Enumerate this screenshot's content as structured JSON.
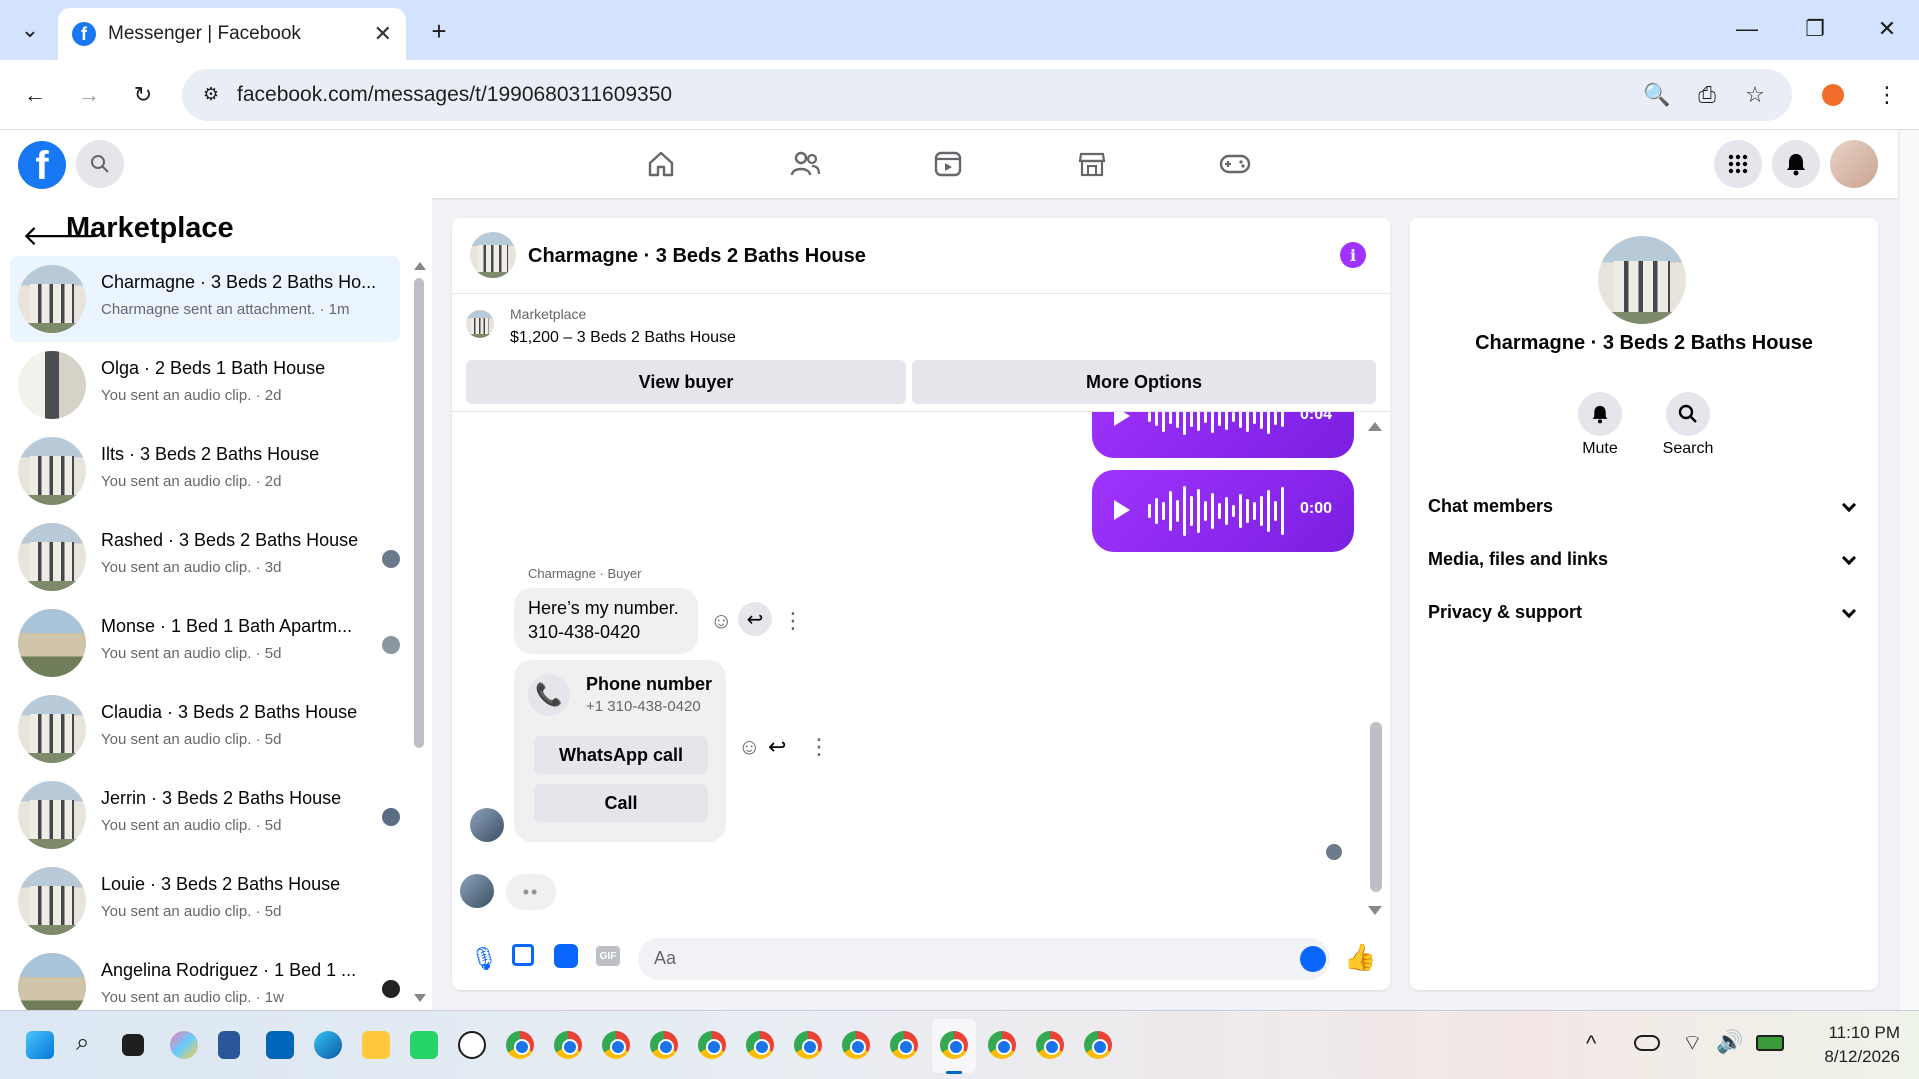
{
  "browser": {
    "tab_title": "Messenger | Facebook",
    "url": "facebook.com/messages/t/1990680311609350"
  },
  "sidebar": {
    "title": "Marketplace",
    "conversations": [
      {
        "name": "Charmagne · 3 Beds 2 Baths Ho...",
        "sub": "Charmagne sent an attachment. · 1m"
      },
      {
        "name": "Olga · 2 Beds 1 Bath House",
        "sub": "You sent an audio clip. · 2d"
      },
      {
        "name": "Ilts · 3 Beds 2 Baths House",
        "sub": "You sent an audio clip. · 2d"
      },
      {
        "name": "Rashed · 3 Beds 2 Baths House",
        "sub": "You sent an audio clip. · 3d"
      },
      {
        "name": "Monse · 1 Bed 1 Bath Apartm...",
        "sub": "You sent an audio clip. · 5d"
      },
      {
        "name": "Claudia · 3 Beds 2 Baths House",
        "sub": "You sent an audio clip. · 5d"
      },
      {
        "name": "Jerrin · 3 Beds 2 Baths House",
        "sub": "You sent an audio clip. · 5d"
      },
      {
        "name": "Louie · 3 Beds 2 Baths House",
        "sub": "You sent an audio clip. · 5d"
      },
      {
        "name": "Angelina Rodriguez · 1 Bed 1 ...",
        "sub": "You sent an audio clip. · 1w"
      }
    ]
  },
  "chat": {
    "title": "Charmagne · 3 Beds 2 Baths House",
    "marketplace_label": "Marketplace",
    "listing": "$1,200 – 3 Beds 2 Baths House",
    "view_buyer": "View buyer",
    "more_options": "More Options",
    "voice_msgs": [
      {
        "duration": "0:04"
      },
      {
        "duration": "0:00"
      }
    ],
    "sender_label": "Charmagne · Buyer",
    "message_line1": "Here’s my number.",
    "message_line2": "310-438-0420",
    "phone_card": {
      "title": "Phone number",
      "number": "+1 310-438-0420",
      "whatsapp_btn": "WhatsApp call",
      "call_btn": "Call"
    },
    "composer_placeholder": "Aa"
  },
  "right_panel": {
    "name": "Charmagne · 3 Beds 2 Baths House",
    "mute": "Mute",
    "search": "Search",
    "sections": [
      "Chat members",
      "Media, files and links",
      "Privacy & support"
    ]
  },
  "taskbar": {
    "time": "11:10 PM",
    "date": "8/12/2026"
  },
  "colors": {
    "fb_blue": "#1877f2",
    "messenger_purple": "#a033ff",
    "active_conv": "#ebf5ff"
  }
}
